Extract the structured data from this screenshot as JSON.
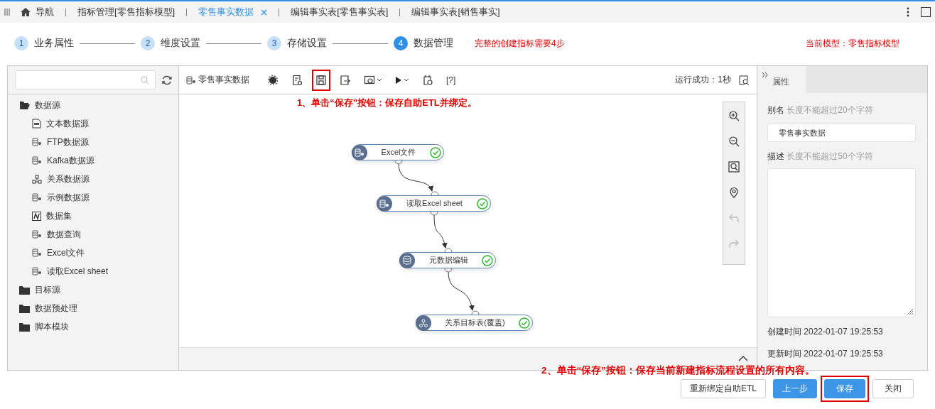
{
  "tab_bar": {
    "nav_label": "导航",
    "tabs": [
      {
        "label": "指标管理[零售指标模型]",
        "selected": false,
        "closable": false
      },
      {
        "label": "零售事实数据",
        "selected": true,
        "closable": true
      },
      {
        "label": "编辑事实表[零售事实表]",
        "selected": false,
        "closable": false
      },
      {
        "label": "编辑事实表[销售事实]",
        "selected": false,
        "closable": false
      }
    ]
  },
  "steps": [
    {
      "number": "1",
      "label": "业务属性",
      "selected": false
    },
    {
      "number": "2",
      "label": "维度设置",
      "selected": false
    },
    {
      "number": "3",
      "label": "存储设置",
      "selected": false
    },
    {
      "number": "4",
      "label": "数据管理",
      "selected": true
    }
  ],
  "step_hint": "完整的创建指标需要4步",
  "current_model": "当前模型：零售指标模型",
  "tree": {
    "items": [
      {
        "kind": "folder",
        "label": "数据源",
        "expanded": true,
        "children": [
          {
            "kind": "tds",
            "label": "文本数据源"
          },
          {
            "kind": "db",
            "label": "FTP数据源"
          },
          {
            "kind": "db",
            "label": "Kafka数据源"
          },
          {
            "kind": "relation",
            "label": "关系数据源"
          },
          {
            "kind": "db",
            "label": "示例数据源"
          },
          {
            "kind": "dataset",
            "label": "数据集"
          },
          {
            "kind": "db",
            "label": "数据查询"
          },
          {
            "kind": "db",
            "label": "Excel文件"
          },
          {
            "kind": "db",
            "label": "读取Excel sheet"
          }
        ]
      },
      {
        "kind": "folder",
        "label": "目标源",
        "expanded": false
      },
      {
        "kind": "folder",
        "label": "数据预处理",
        "expanded": false
      },
      {
        "kind": "folder",
        "label": "脚本模块",
        "expanded": false
      }
    ]
  },
  "toolbar": {
    "title": "零售事实数据",
    "save_highlighted": true,
    "help_label": "[?]",
    "status": "运行成功：1秒"
  },
  "canvas": {
    "annotation": "1、单击“保存”按钮：保存自助ETL并绑定。",
    "nodes": [
      {
        "kind": "db",
        "label": "Excel文件",
        "ok": true
      },
      {
        "kind": "db",
        "label": "读取Excel sheet",
        "ok": true
      },
      {
        "kind": "meta",
        "label": "元数据编辑",
        "ok": true
      },
      {
        "kind": "relation",
        "label": "关系目标表(覆盖)",
        "ok": true
      }
    ]
  },
  "properties": {
    "tab": "属性",
    "alias_label": "别名",
    "alias_hint": "长度不能超过20个字符",
    "alias_value": "零售事实数据",
    "desc_label": "描述",
    "desc_hint": "长度不能超过50个字符",
    "created": "创建时间 2022-01-07 19:25:53",
    "updated": "更新时间 2022-01-07 19:25:53"
  },
  "footer_annotation": "2、单击“保存”按钮：保存当前新建指标流程设置的所有内容。",
  "buttons": [
    {
      "label": "重新绑定自助ETL",
      "kind": "default",
      "highlighted": false
    },
    {
      "label": "上一步",
      "kind": "primary",
      "highlighted": false
    },
    {
      "label": "保存",
      "kind": "primary",
      "highlighted": true
    },
    {
      "label": "关闭",
      "kind": "default",
      "highlighted": false
    }
  ]
}
